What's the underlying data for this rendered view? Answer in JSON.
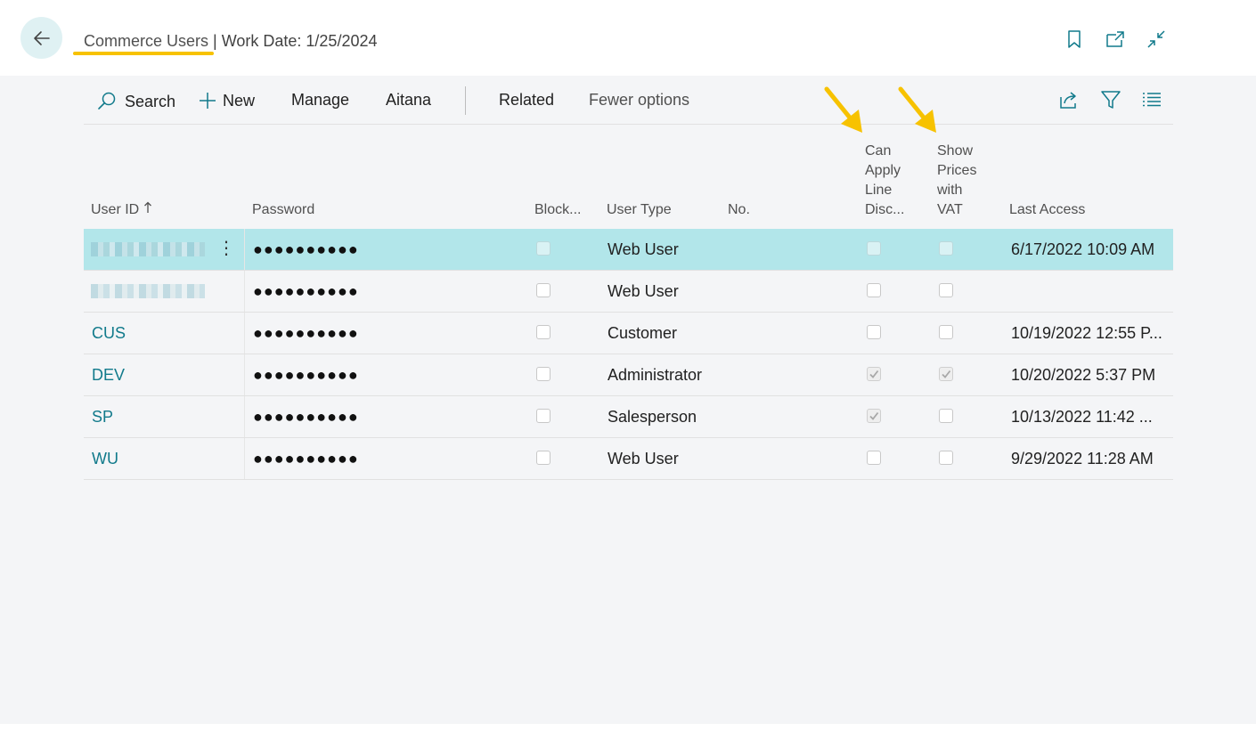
{
  "header": {
    "page_name": "Commerce Users",
    "separator": " | ",
    "work_date": "Work Date: 1/25/2024"
  },
  "actions": {
    "search": "Search",
    "new": "New",
    "manage": "Manage",
    "aitana": "Aitana",
    "related": "Related",
    "fewer_options": "Fewer options"
  },
  "columns": {
    "user_id": "User ID",
    "password": "Password",
    "blocked": "Block...",
    "user_type": "User Type",
    "no": "No.",
    "can_apply_line_disc": "Can Apply Line Disc...",
    "show_prices_with_vat": "Show Prices with VAT",
    "last_access": "Last Access"
  },
  "rows": [
    {
      "user_id": "",
      "password": "●●●●●●●●●●",
      "blocked": false,
      "user_type": "Web User",
      "no": "",
      "can_apply_line_disc": false,
      "show_prices_with_vat": false,
      "last_access": "6/17/2022 10:09 AM"
    },
    {
      "user_id": "",
      "password": "●●●●●●●●●●",
      "blocked": false,
      "user_type": "Web User",
      "no": "",
      "can_apply_line_disc": false,
      "show_prices_with_vat": false,
      "last_access": ""
    },
    {
      "user_id": "CUS",
      "password": "●●●●●●●●●●",
      "blocked": false,
      "user_type": "Customer",
      "no": "",
      "can_apply_line_disc": false,
      "show_prices_with_vat": false,
      "last_access": "10/19/2022 12:55 P..."
    },
    {
      "user_id": "DEV",
      "password": "●●●●●●●●●●",
      "blocked": false,
      "user_type": "Administrator",
      "no": "",
      "can_apply_line_disc": true,
      "show_prices_with_vat": true,
      "last_access": "10/20/2022 5:37 PM"
    },
    {
      "user_id": "SP",
      "password": "●●●●●●●●●●",
      "blocked": false,
      "user_type": "Salesperson",
      "no": "",
      "can_apply_line_disc": true,
      "show_prices_with_vat": false,
      "last_access": "10/13/2022 11:42 ..."
    },
    {
      "user_id": "WU",
      "password": "●●●●●●●●●●",
      "blocked": false,
      "user_type": "Web User",
      "no": "",
      "can_apply_line_disc": false,
      "show_prices_with_vat": false,
      "last_access": "9/29/2022 11:28 AM"
    }
  ],
  "colors": {
    "accent": "#117a8b",
    "selected_row": "#b2e6ea",
    "highlight": "#f7c200"
  },
  "icons": [
    "back-arrow-icon",
    "bookmark-icon",
    "open-in-new-window-icon",
    "collapse-icon",
    "search-icon",
    "plus-icon",
    "share-icon",
    "filter-icon",
    "list-view-icon",
    "sort-ascending-icon"
  ]
}
